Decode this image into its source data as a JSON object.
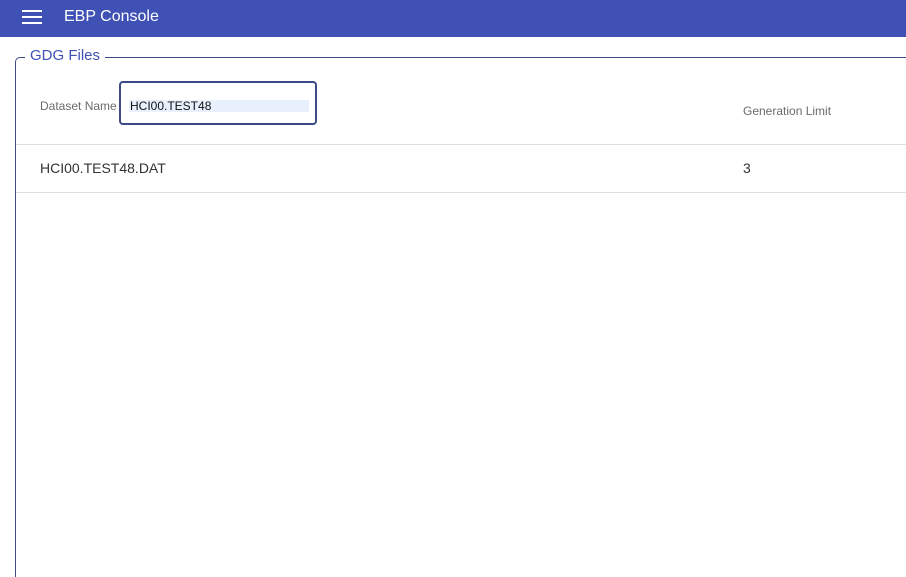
{
  "app": {
    "title": "EBP Console"
  },
  "panel": {
    "legend": "GDG Files"
  },
  "filter": {
    "dataset_name_label": "Dataset Name",
    "dataset_name_value": "HCI00.TEST48",
    "generation_limit_label": "Generation Limit"
  },
  "table": {
    "rows": [
      {
        "dataset_name": "HCI00.TEST48.DAT",
        "generation_limit": "3"
      }
    ]
  },
  "colors": {
    "appbar": "#3f51b5",
    "accent": "#3c4a87"
  }
}
